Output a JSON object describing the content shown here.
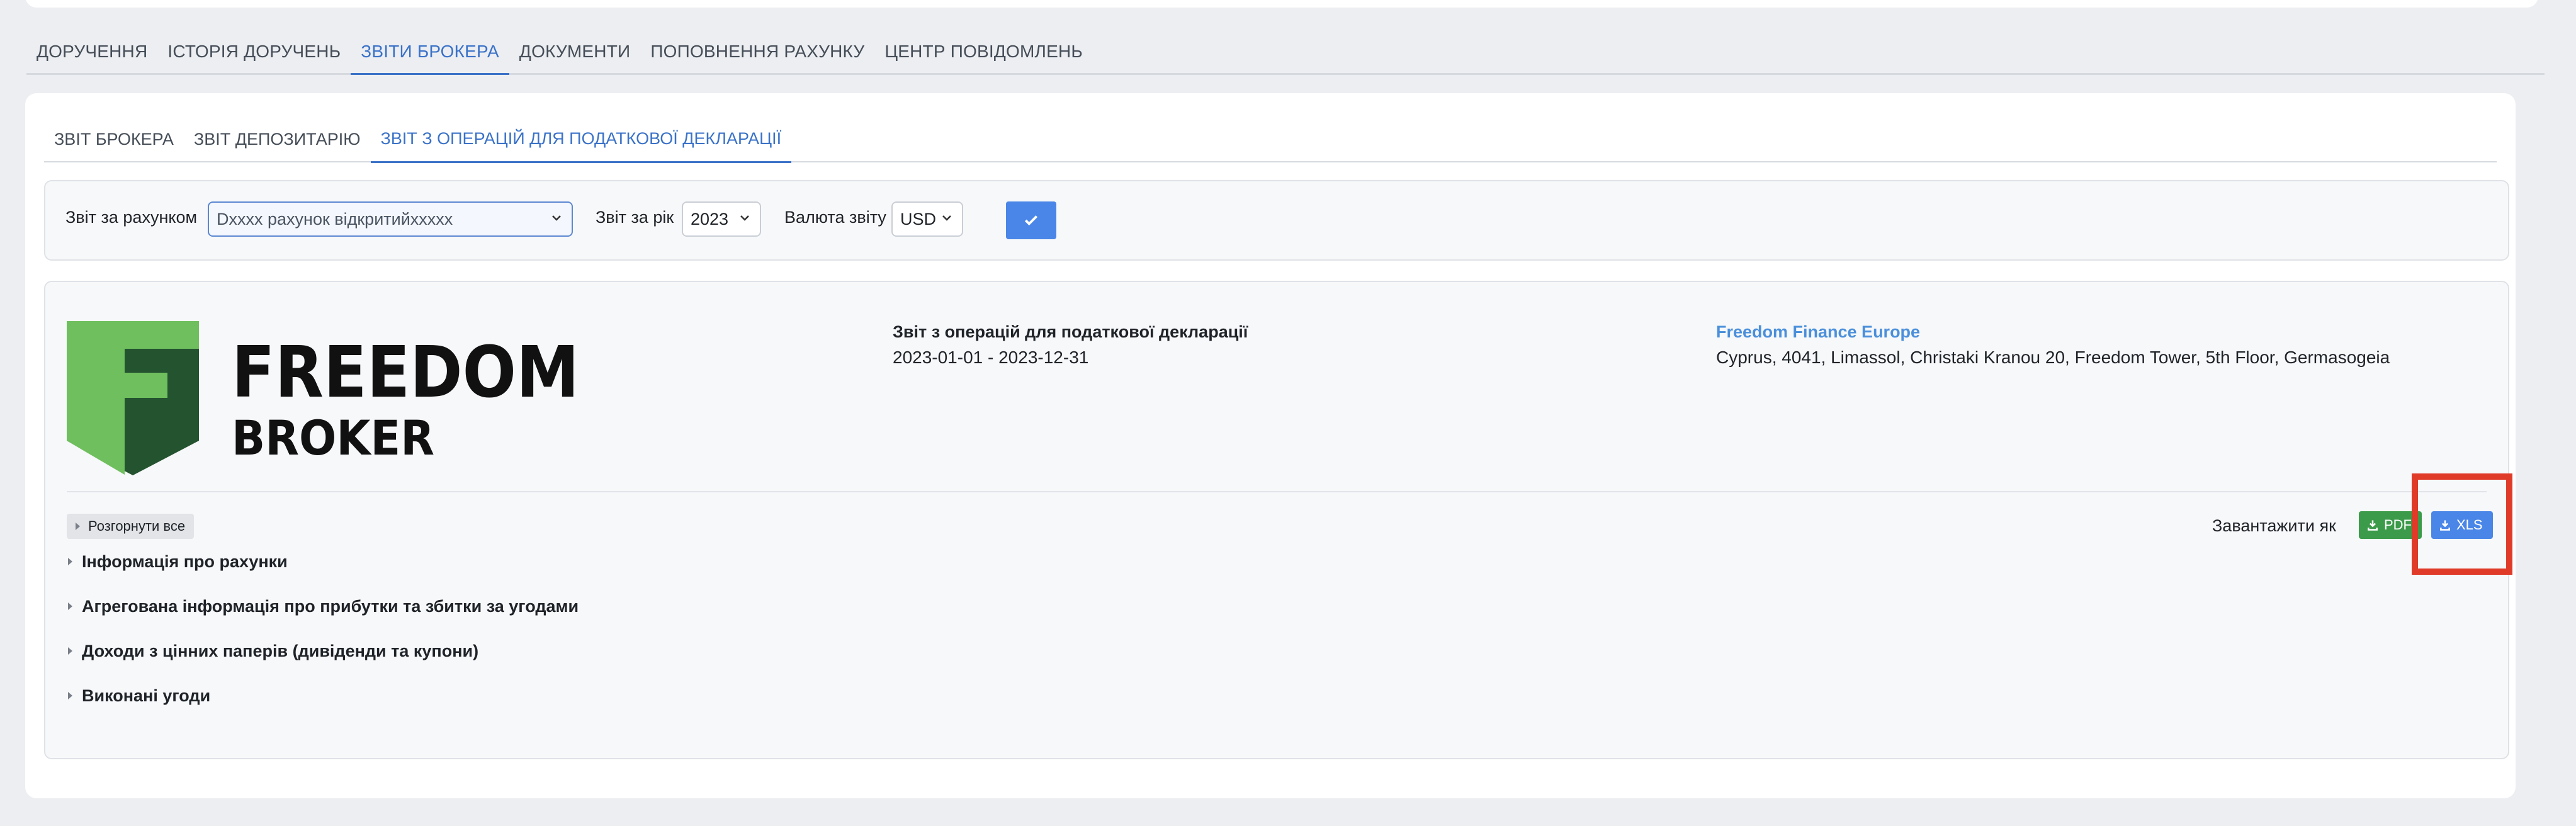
{
  "main_tabs": [
    {
      "label": "ДОРУЧЕННЯ"
    },
    {
      "label": "ІСТОРІЯ ДОРУЧЕНЬ"
    },
    {
      "label": "ЗВІТИ БРОКЕРА",
      "active": true
    },
    {
      "label": "ДОКУМЕНТИ"
    },
    {
      "label": "ПОПОВНЕННЯ РАХУНКУ"
    },
    {
      "label": "ЦЕНТР ПОВІДОМЛЕНЬ"
    }
  ],
  "sub_tabs": [
    {
      "label": "ЗВІТ БРОКЕРА"
    },
    {
      "label": "ЗВІТ ДЕПОЗИТАРІЮ"
    },
    {
      "label": "ЗВІТ З ОПЕРАЦІЙ ДЛЯ ПОДАТКОВОЇ ДЕКЛАРАЦІЇ",
      "active": true
    }
  ],
  "filters": {
    "account_label": "Звіт за рахунком",
    "account_value": "Dxxxx рахунок відкритийxxxxx",
    "year_label": "Звіт за рік",
    "year_value": "2023",
    "currency_label": "Валюта звіту",
    "currency_value": "USD"
  },
  "report": {
    "logo_text_line1": "FREEDOM",
    "logo_text_line2": "BROKER",
    "title": "Звіт з операцій для податкової декларації",
    "dates": "2023-01-01 - 2023-12-31",
    "company_name": "Freedom Finance Europe",
    "company_address": "Cyprus, 4041, Limassol, Christaki Kranou 20, Freedom Tower, 5th Floor, Germasogeia",
    "expand_all": "Розгорнути все",
    "download_label": "Завантажити як",
    "pdf_label": "PDF",
    "xls_label": "XLS",
    "sections": [
      "Інформація про рахунки",
      "Агрегована інформація про прибутки та збитки за угодами",
      "Доходи з цінних паперів (дивіденди та купони)",
      "Виконані угоди"
    ]
  },
  "colors": {
    "accent": "#4a86e8",
    "pdf_button": "#3c9b4a",
    "highlight": "#e03a28",
    "logo_green_light": "#6fbf5e",
    "logo_green_dark": "#24532f"
  }
}
